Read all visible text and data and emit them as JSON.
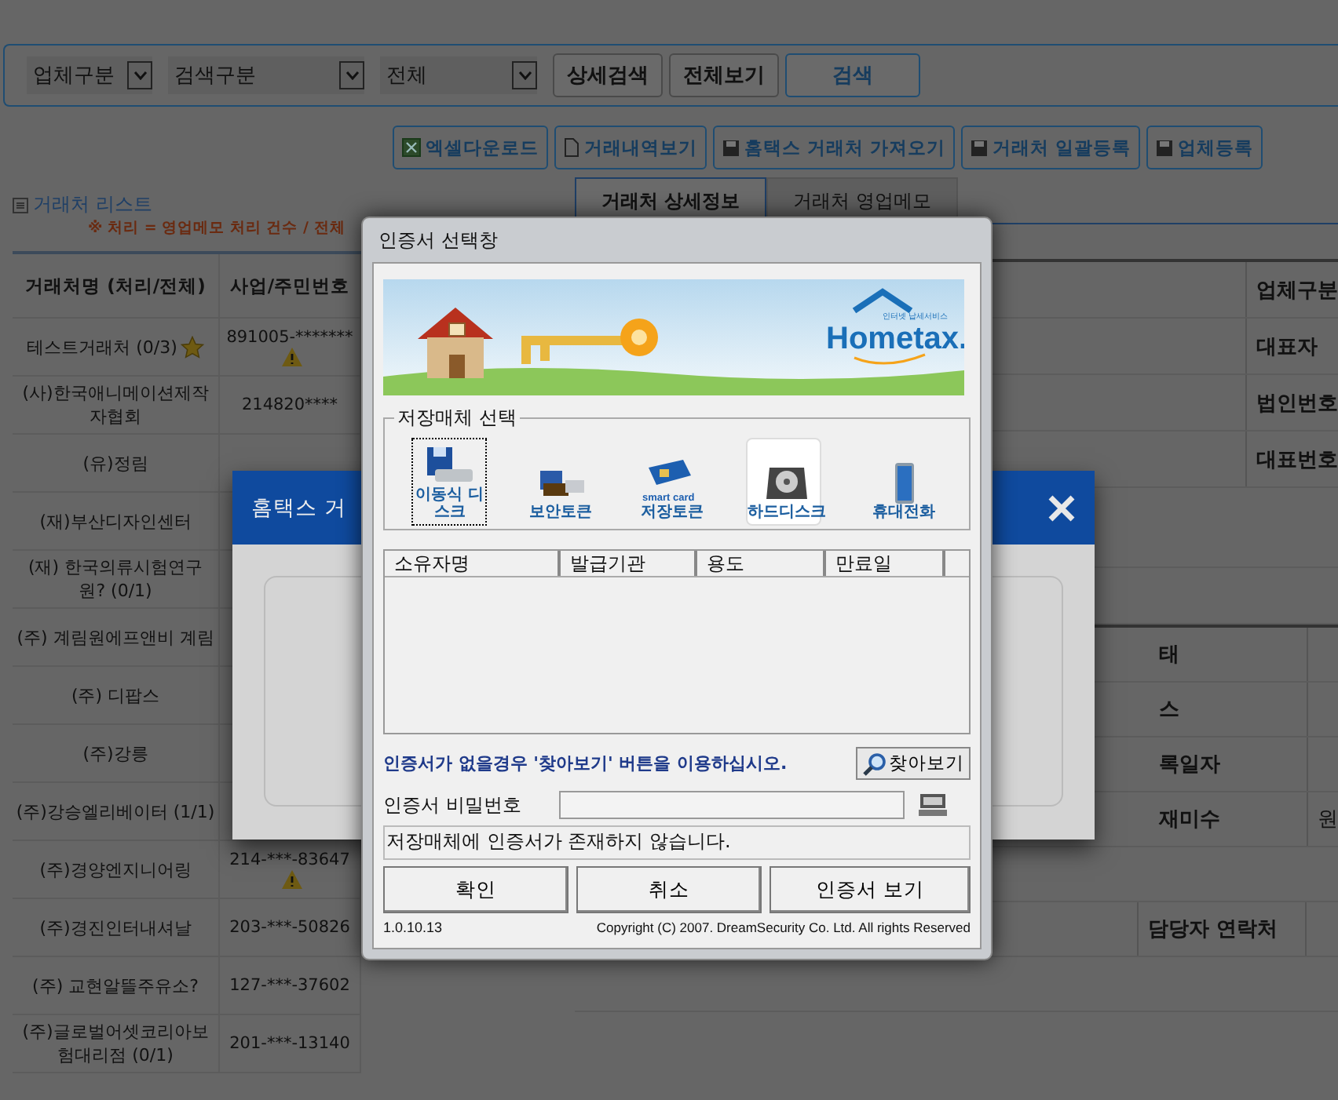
{
  "search_bar": {
    "selects": [
      {
        "value": "업체구분"
      },
      {
        "value": "검색구분"
      },
      {
        "value": "전체"
      }
    ],
    "buttons": [
      {
        "label": "상세검색",
        "kind": "plain"
      },
      {
        "label": "전체보기",
        "kind": "plain"
      },
      {
        "label": "검색",
        "kind": "primary"
      }
    ]
  },
  "action_buttons": [
    {
      "label": "엑셀다운로드",
      "kind": "excel"
    },
    {
      "label": "거래내역보기",
      "kind": "page"
    },
    {
      "label": "홈택스 거래처 가져오기",
      "kind": "disk"
    },
    {
      "label": "거래처 일괄등록",
      "kind": "disk"
    },
    {
      "label": "업체등록",
      "kind": "disk"
    }
  ],
  "client_list": {
    "title": "거래처 리스트",
    "note": "※ 처리 = 영업메모 처리 건수 / 전체",
    "columns": [
      "거래처명 (처리/전체)",
      "사업/주민번호"
    ],
    "rows": [
      {
        "name": "테스트거래처 (0/3)",
        "starred": true,
        "number": "891005-*******",
        "warning": true
      },
      {
        "name": "(사)한국애니메이션제작자협회",
        "number": "214820****"
      },
      {
        "name": "(유)정림"
      },
      {
        "name": "(재)부산디자인센터"
      },
      {
        "name": "(재) 한국의류시험연구원? (0/1)"
      },
      {
        "name": "(주) 계림원에프앤비 계림"
      },
      {
        "name": "(주) 디팝스"
      },
      {
        "name": "(주)강릉"
      },
      {
        "name": "(주)강승엘리베이터 (1/1)"
      },
      {
        "name": "(주)경양엔지니어링",
        "number": "214-***-83647",
        "warning": true
      },
      {
        "name": "(주)경진인터내셔날",
        "number": "203-***-50826"
      },
      {
        "name": "(주) 교현알뜰주유소?",
        "number": "127-***-37602"
      },
      {
        "name": "(주)글로벌어셋코리아보험대리점 (0/1)",
        "number": "201-***-13140"
      }
    ]
  },
  "detail": {
    "tabs": [
      {
        "label": "거래처 상세정보",
        "selected": true
      },
      {
        "label": "거래처 영업메모",
        "selected": false
      }
    ],
    "info_rows": [
      {
        "label": "업체구분"
      },
      {
        "label": "대표자"
      },
      {
        "label": "법인번호"
      },
      {
        "label": "대표번호"
      }
    ],
    "lower_rows": [
      {
        "label": "태"
      },
      {
        "label": "스"
      },
      {
        "label": "록일자"
      },
      {
        "label": "재미수",
        "value": "원"
      }
    ],
    "contact_label": "담당자 연락처"
  },
  "hometax_modal": {
    "title": "홈택스 거"
  },
  "cert_dialog": {
    "title": "인증서 선택창",
    "banner_logo": "Hometax.",
    "banner_tagline": "인터넷 납세서비스",
    "storage_group": "저장매체 선택",
    "storage_options": [
      {
        "label": "이동식 디스크",
        "kind": "usb",
        "selected": false,
        "focused": true
      },
      {
        "label": "보안토큰",
        "kind": "token",
        "selected": false,
        "focused": false
      },
      {
        "label": "저장토큰",
        "kind": "smartcard",
        "selected": false,
        "focused": false
      },
      {
        "label": "하드디스크",
        "kind": "harddisk",
        "selected": true,
        "focused": false
      },
      {
        "label": "휴대전화",
        "kind": "phone",
        "selected": false,
        "focused": false
      }
    ],
    "smartcard_text": "smart card",
    "columns": [
      "소유자명",
      "발급기관",
      "용도",
      "만료일"
    ],
    "hint": "인증서가 없을경우 '찾아보기' 버튼을 이용하십시오.",
    "browse_button": "찾아보기",
    "password_label": "인증서 비밀번호",
    "status": "저장매체에 인증서가 존재하지 않습니다.",
    "buttons": [
      "확인",
      "취소",
      "인증서 보기"
    ],
    "version": "1.0.10.13",
    "copyright": "Copyright (C) 2007. DreamSecurity Co. Ltd. All rights Reserved"
  }
}
